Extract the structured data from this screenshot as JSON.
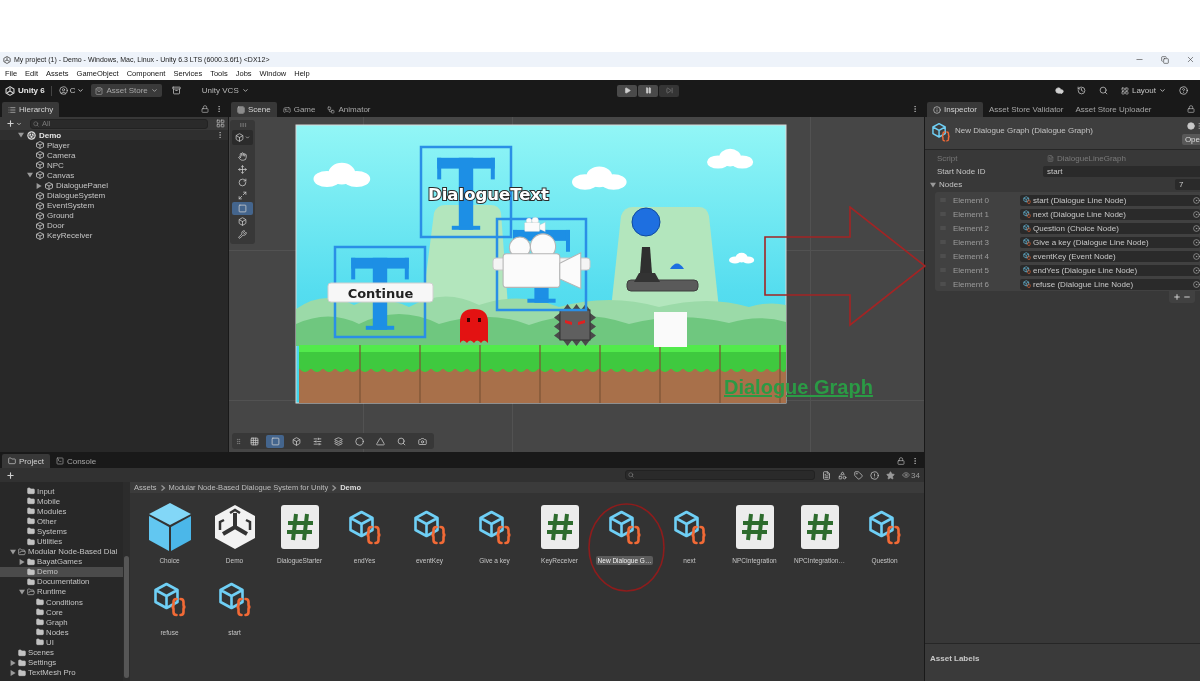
{
  "window": {
    "title": "My project (1) - Demo - Windows, Mac, Linux - Unity 6.3 LTS (6000.3.6f1) <DX12>"
  },
  "menu": [
    "File",
    "Edit",
    "Assets",
    "GameObject",
    "Component",
    "Services",
    "Tools",
    "Jobs",
    "Window",
    "Help"
  ],
  "toolbar": {
    "product": "Unity 6",
    "account": "C",
    "store": "Asset Store",
    "vcs": "Unity VCS",
    "layout": "Layout"
  },
  "hierarchy": {
    "tab": "Hierarchy",
    "search": {
      "placeholder": "All"
    },
    "tree": [
      {
        "label": "Demo",
        "kind": "scene",
        "expanded": true,
        "children": [
          {
            "label": "Player",
            "kind": "object"
          },
          {
            "label": "Camera",
            "kind": "object"
          },
          {
            "label": "NPC",
            "kind": "object"
          },
          {
            "label": "Canvas",
            "kind": "object",
            "expanded": true,
            "children": [
              {
                "label": "DialoguePanel",
                "kind": "object",
                "expanded": false
              }
            ]
          },
          {
            "label": "DialogueSystem",
            "kind": "object"
          },
          {
            "label": "EventSystem",
            "kind": "object"
          },
          {
            "label": "Ground",
            "kind": "object"
          },
          {
            "label": "Door",
            "kind": "object"
          },
          {
            "label": "KeyReceiver",
            "kind": "object"
          }
        ]
      }
    ]
  },
  "scene": {
    "tabs": [
      {
        "label": "Scene",
        "selected": true
      },
      {
        "label": "Game",
        "selected": false
      },
      {
        "label": "Animator",
        "selected": false
      }
    ],
    "tools": [
      {
        "selected": false
      },
      {
        "selected": false
      },
      {
        "selected": false
      },
      {
        "selected": false
      },
      {
        "selected": true
      },
      {
        "selected": false
      },
      {
        "selected": false
      }
    ],
    "overlay_tools": [
      {
        "selected": false
      },
      {
        "selected": true
      },
      {
        "selected": false
      },
      {
        "selected": false
      },
      {
        "selected": false
      },
      {
        "selected": false
      },
      {
        "selected": false
      },
      {
        "selected": false
      },
      {
        "selected": false
      }
    ],
    "game_ui": {
      "dialogue_text": "DialogueText",
      "button_label": "Continue"
    }
  },
  "annotation": {
    "label": "Dialogue Graph"
  },
  "inspector": {
    "tabs": [
      {
        "label": "Inspector",
        "selected": true
      },
      {
        "label": "Asset Store Validator",
        "selected": false
      },
      {
        "label": "Asset Store Uploader",
        "selected": false
      }
    ],
    "title": "New Dialogue Graph (Dialogue Graph)",
    "open_button": "Ope",
    "fields": [
      {
        "label": "Script",
        "value": "DialogueLineGraph",
        "disabled": true
      },
      {
        "label": "Start Node ID",
        "value": "start",
        "disabled": false
      }
    ],
    "list": {
      "label": "Nodes",
      "expanded": true,
      "count": "7",
      "items": [
        {
          "label": "Element 0",
          "value": "start (Dialogue Line Node)"
        },
        {
          "label": "Element 1",
          "value": "next (Dialogue Line Node)"
        },
        {
          "label": "Element 2",
          "value": "Question (Choice Node)"
        },
        {
          "label": "Element 3",
          "value": "Give a key (Dialogue Line Node)"
        },
        {
          "label": "Element 4",
          "value": "eventKey (Event Node)"
        },
        {
          "label": "Element 5",
          "value": "endYes (Dialogue Line Node)"
        },
        {
          "label": "Element 6",
          "value": "refuse (Dialogue Line Node)"
        }
      ]
    },
    "footer": "Asset Labels"
  },
  "project": {
    "tabs": [
      {
        "label": "Project",
        "selected": true
      },
      {
        "label": "Console",
        "selected": false
      }
    ],
    "tree": [
      {
        "children": [
          {
            "label": "Input",
            "selected": false
          },
          {
            "label": "Mobile",
            "selected": false
          },
          {
            "label": "Modules",
            "selected": false
          },
          {
            "label": "Other",
            "selected": false
          },
          {
            "label": "Systems",
            "selected": false
          },
          {
            "label": "Utilities",
            "selected": false
          }
        ]
      },
      {
        "label": "Modular Node-Based Dial",
        "selected": false,
        "expanded": true,
        "children": [
          {
            "label": "BayatGames",
            "selected": false,
            "expanded": false
          },
          {
            "label": "Demo",
            "selected": true
          },
          {
            "label": "Documentation",
            "selected": false
          },
          {
            "label": "Runtime",
            "selected": false,
            "expanded": true,
            "children": [
              {
                "label": "Conditions",
                "selected": false
              },
              {
                "label": "Core",
                "selected": false
              },
              {
                "label": "Graph",
                "selected": false
              },
              {
                "label": "Nodes",
                "selected": false
              },
              {
                "label": "UI",
                "selected": false
              }
            ]
          }
        ]
      },
      {
        "label": "Scenes",
        "selected": false
      },
      {
        "label": "Settings",
        "selected": false,
        "expanded": false
      },
      {
        "label": "TextMesh Pro",
        "selected": false,
        "expanded": false
      }
    ],
    "breadcrumb": [
      "Assets",
      "Modular Node-Based Dialogue System for Unity",
      "Demo"
    ],
    "count": "34",
    "assets": [
      {
        "name": "Choice",
        "kind": "prefab",
        "selected": false
      },
      {
        "name": "Demo",
        "kind": "scene",
        "selected": false
      },
      {
        "name": "DialogueStarter",
        "kind": "script",
        "selected": false
      },
      {
        "name": "endYes",
        "kind": "asset",
        "selected": false
      },
      {
        "name": "eventKey",
        "kind": "asset",
        "selected": false
      },
      {
        "name": "Give a key",
        "kind": "asset",
        "selected": false
      },
      {
        "name": "KeyReceiver",
        "kind": "script",
        "selected": false
      },
      {
        "name": "New Dialogue G…",
        "kind": "asset",
        "selected": true
      },
      {
        "name": "next",
        "kind": "asset",
        "selected": false
      },
      {
        "name": "NPCIntegration",
        "kind": "script",
        "selected": false
      },
      {
        "name": "NPCIntegration…",
        "kind": "script",
        "selected": false
      },
      {
        "name": "Question",
        "kind": "asset",
        "selected": false
      },
      {
        "name": "refuse",
        "kind": "asset",
        "selected": false
      },
      {
        "name": "start",
        "kind": "asset",
        "selected": false
      }
    ]
  }
}
